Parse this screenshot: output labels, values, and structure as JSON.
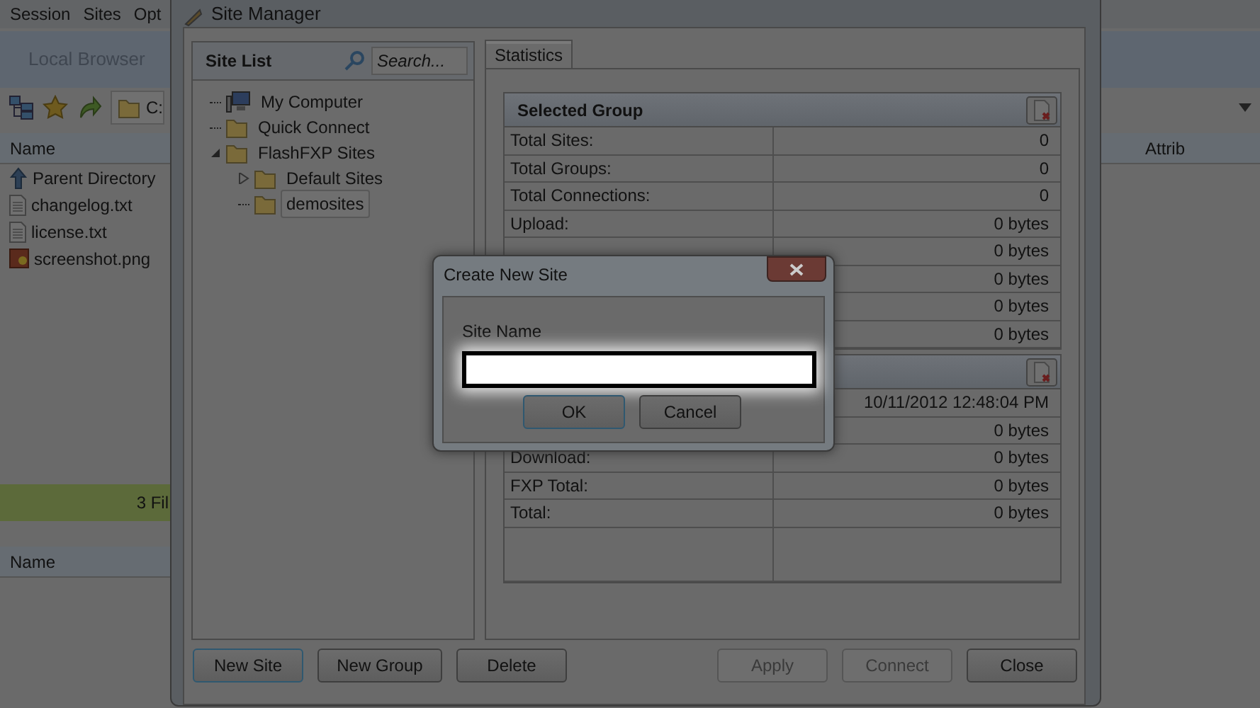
{
  "main_window": {
    "menu": [
      "Session",
      "Sites",
      "Opt"
    ],
    "tab": "Local Browser",
    "path": "C:",
    "columns": [
      "Name",
      "Attrib"
    ],
    "files": [
      {
        "name": "Parent Directory",
        "kind": "parent"
      },
      {
        "name": "changelog.txt",
        "kind": "text"
      },
      {
        "name": "license.txt",
        "kind": "text"
      },
      {
        "name": "screenshot.png",
        "kind": "image"
      }
    ],
    "status": "3 Fil",
    "lower_columns": [
      "Name"
    ]
  },
  "site_manager": {
    "title": "Site Manager",
    "site_list": {
      "title": "Site List",
      "search_placeholder": "Search...",
      "tree": [
        {
          "label": "My Computer",
          "kind": "computer",
          "selected": false
        },
        {
          "label": "Quick Connect",
          "kind": "folder",
          "selected": false
        },
        {
          "label": "FlashFXP Sites",
          "kind": "folder",
          "selected": false,
          "expanded": true,
          "children": [
            {
              "label": "Default Sites",
              "kind": "folder",
              "selected": false,
              "expanded": false
            },
            {
              "label": "demosites",
              "kind": "folder",
              "selected": true
            }
          ]
        }
      ]
    },
    "tabs": [
      {
        "label": "Statistics",
        "selected": true
      }
    ],
    "groups": [
      {
        "title": "Selected Group",
        "rows": [
          {
            "label": "Total Sites:",
            "value": "0"
          },
          {
            "label": "Total Groups:",
            "value": "0"
          },
          {
            "label": "Total Connections:",
            "value": "0"
          },
          {
            "label": "Upload:",
            "value": "0 bytes"
          },
          {
            "value": "0 bytes"
          },
          {
            "value": "0 bytes"
          },
          {
            "value": "0 bytes"
          },
          {
            "value": "0 bytes"
          }
        ]
      },
      {
        "rows": [
          {
            "value": "10/11/2012 12:48:04 PM"
          },
          {
            "value": "0 bytes"
          },
          {
            "label": "Download:",
            "value": "0 bytes"
          },
          {
            "label": "FXP Total:",
            "value": "0 bytes"
          },
          {
            "label": "Total:",
            "value": "0 bytes"
          }
        ]
      }
    ],
    "buttons": [
      {
        "label": "New Site",
        "disabled": false,
        "focused": true
      },
      {
        "label": "New Group",
        "disabled": false,
        "focused": false
      },
      {
        "label": "Delete",
        "disabled": false,
        "focused": false
      },
      {
        "label": "Apply",
        "disabled": true,
        "focused": false
      },
      {
        "label": "Connect",
        "disabled": true,
        "focused": false
      },
      {
        "label": "Close",
        "disabled": false,
        "focused": false
      }
    ]
  },
  "dialog": {
    "title": "Create New Site",
    "field_label": "Site Name",
    "buttons": [
      {
        "label": "OK",
        "focused": true
      },
      {
        "label": "Cancel",
        "focused": false
      }
    ]
  }
}
